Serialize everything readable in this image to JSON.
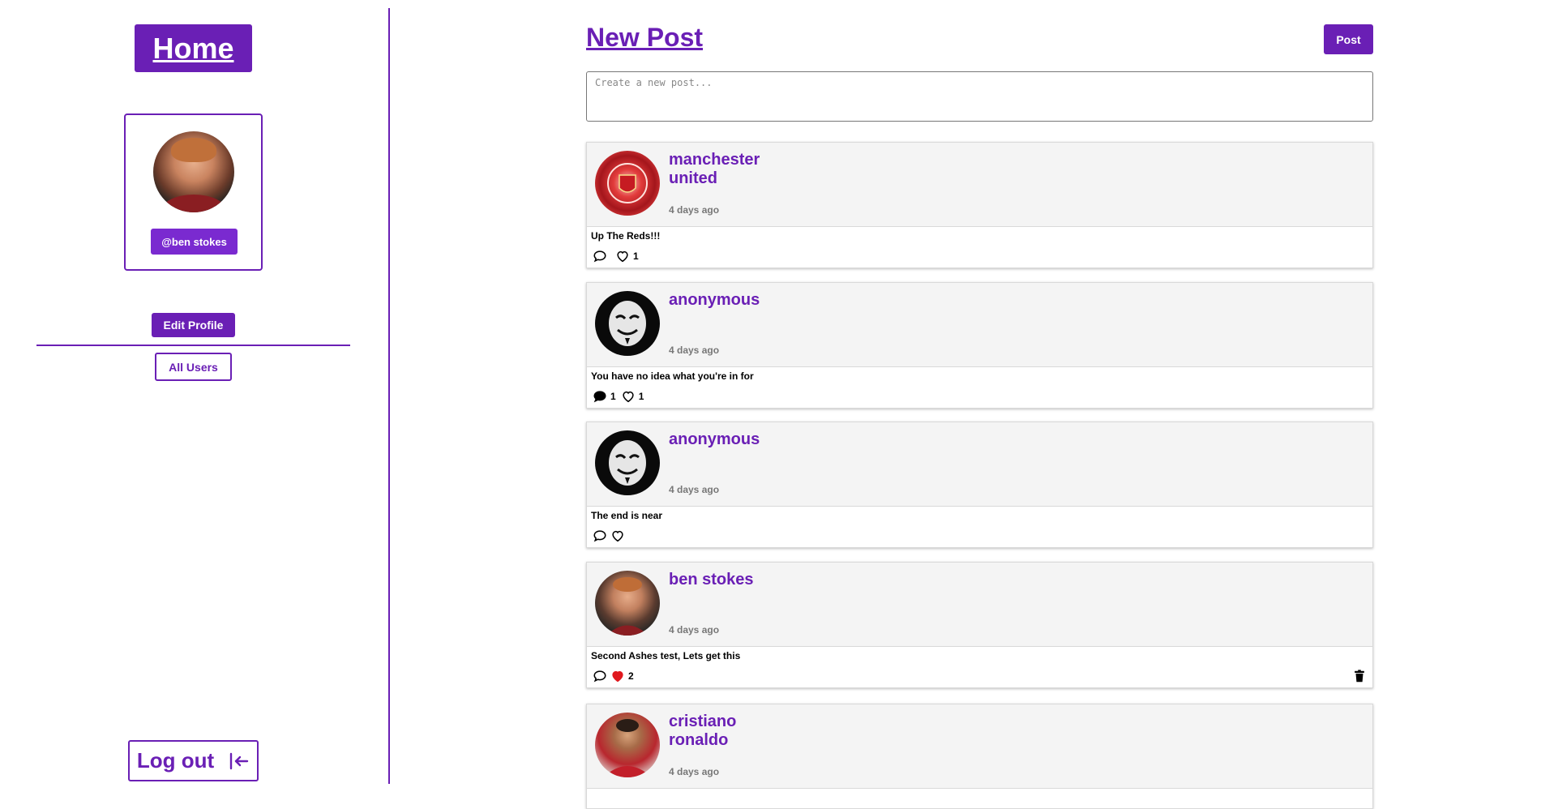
{
  "sidebar": {
    "home_label": "Home",
    "handle": "@ben stokes",
    "edit_profile_label": "Edit Profile",
    "all_users_label": "All Users",
    "logout_label": "Log out"
  },
  "composer": {
    "title": "New Post",
    "post_button_label": "Post",
    "placeholder": "Create a new post..."
  },
  "posts": [
    {
      "author": "manchester united",
      "time": "4 days ago",
      "text": "Up The Reds!!!",
      "comments": "",
      "likes": "1",
      "liked": false,
      "commented": false,
      "deletable": false
    },
    {
      "author": "anonymous",
      "time": "4 days ago",
      "text": "You have no idea what you're in for",
      "comments": "1",
      "likes": "1",
      "liked": false,
      "commented": true,
      "deletable": false
    },
    {
      "author": "anonymous",
      "time": "4 days ago",
      "text": "The end is near",
      "comments": "",
      "likes": "",
      "liked": false,
      "commented": false,
      "deletable": false
    },
    {
      "author": "ben stokes",
      "time": "4 days ago",
      "text": "Second Ashes test, Lets get this",
      "comments": "",
      "likes": "2",
      "liked": true,
      "commented": false,
      "deletable": true
    },
    {
      "author": "cristiano ronaldo",
      "time": "4 days ago",
      "text": "",
      "comments": "",
      "likes": "",
      "liked": false,
      "commented": false,
      "deletable": false
    }
  ],
  "colors": {
    "accent": "#6a1fb5",
    "like_active": "#e0191f"
  }
}
